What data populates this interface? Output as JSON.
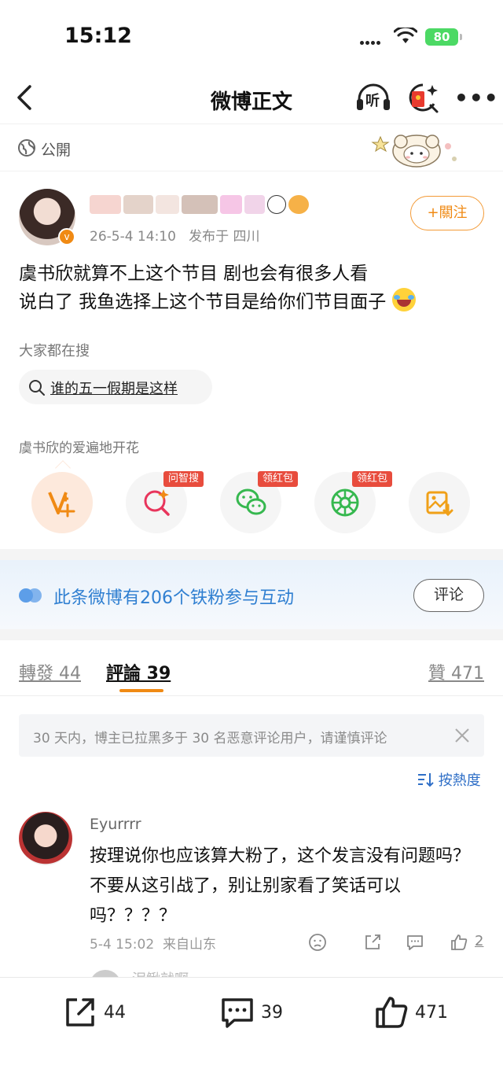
{
  "status_bar": {
    "time": "15:12",
    "battery": "80"
  },
  "nav": {
    "title": "微博正文",
    "listen_label": "听"
  },
  "visibility": {
    "label": "公開"
  },
  "post": {
    "meta": "26-5-4 14:10   发布于 四川",
    "follow_label": "+關注",
    "text_line1": "虞书欣就算不上这个节目 剧也会有很多人看",
    "text_line2": "说白了 我鱼选择上这个节目是给你们节目面子"
  },
  "hot_search": {
    "heading": "大家都在搜",
    "query": "谁的五一假期是这样"
  },
  "love": {
    "heading": "虞书欣的爱遍地开花",
    "tags": [
      "问智搜",
      "领红包",
      "领红包"
    ]
  },
  "fans_bar": {
    "text": "此条微博有206个铁粉参与互动",
    "button": "评论"
  },
  "tabs": {
    "forward": "轉發 44",
    "comment": "評論 39",
    "like": "贊 471"
  },
  "notice": {
    "text": "30 天内，博主已拉黑多于 30 名恶意评论用户，请谨慎评论"
  },
  "sort": {
    "label": "按熱度"
  },
  "comment": {
    "username": "Eyurrrr",
    "text": "按理说你也应该算大粉了，这个发言没有问题吗？不要从这引战了，别让别家看了笑话可以吗？？？？",
    "meta": "5-4 15:02  来自山东",
    "likes": "2"
  },
  "next_comment": {
    "username": "泥鳅就啊"
  },
  "bottom_bar": {
    "forward_count": "44",
    "comment_count": "39",
    "like_count": "471"
  },
  "colors": {
    "accent": "#f08a14",
    "link_blue": "#2f7fd1",
    "tag_red": "#e84c3d"
  }
}
